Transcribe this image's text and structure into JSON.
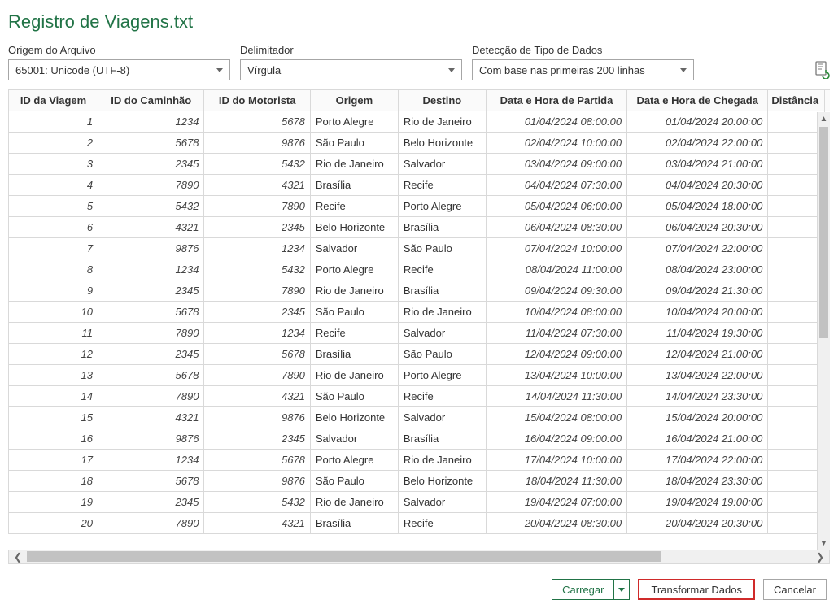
{
  "title": "Registro de Viagens.txt",
  "fields": {
    "origin_label": "Origem do Arquivo",
    "origin_value": "65001: Unicode (UTF-8)",
    "delimiter_label": "Delimitador",
    "delimiter_value": "Vírgula",
    "detect_label": "Detecção de Tipo de Dados",
    "detect_value": "Com base nas primeiras 200 linhas"
  },
  "columns": [
    "ID da Viagem",
    "ID do Caminhão",
    "ID do Motorista",
    "Origem",
    "Destino",
    "Data e Hora de Partida",
    "Data e Hora de Chegada",
    "Distância"
  ],
  "rows": [
    {
      "id": 1,
      "truck": 1234,
      "driver": 5678,
      "orig": "Porto Alegre",
      "dest": "Rio de Janeiro",
      "dep": "01/04/2024 08:00:00",
      "arr": "01/04/2024 20:00:00"
    },
    {
      "id": 2,
      "truck": 5678,
      "driver": 9876,
      "orig": "São Paulo",
      "dest": "Belo Horizonte",
      "dep": "02/04/2024 10:00:00",
      "arr": "02/04/2024 22:00:00"
    },
    {
      "id": 3,
      "truck": 2345,
      "driver": 5432,
      "orig": "Rio de Janeiro",
      "dest": "Salvador",
      "dep": "03/04/2024 09:00:00",
      "arr": "03/04/2024 21:00:00"
    },
    {
      "id": 4,
      "truck": 7890,
      "driver": 4321,
      "orig": "Brasília",
      "dest": "Recife",
      "dep": "04/04/2024 07:30:00",
      "arr": "04/04/2024 20:30:00"
    },
    {
      "id": 5,
      "truck": 5432,
      "driver": 7890,
      "orig": "Recife",
      "dest": "Porto Alegre",
      "dep": "05/04/2024 06:00:00",
      "arr": "05/04/2024 18:00:00"
    },
    {
      "id": 6,
      "truck": 4321,
      "driver": 2345,
      "orig": "Belo Horizonte",
      "dest": "Brasília",
      "dep": "06/04/2024 08:30:00",
      "arr": "06/04/2024 20:30:00"
    },
    {
      "id": 7,
      "truck": 9876,
      "driver": 1234,
      "orig": "Salvador",
      "dest": "São Paulo",
      "dep": "07/04/2024 10:00:00",
      "arr": "07/04/2024 22:00:00"
    },
    {
      "id": 8,
      "truck": 1234,
      "driver": 5432,
      "orig": "Porto Alegre",
      "dest": "Recife",
      "dep": "08/04/2024 11:00:00",
      "arr": "08/04/2024 23:00:00"
    },
    {
      "id": 9,
      "truck": 2345,
      "driver": 7890,
      "orig": "Rio de Janeiro",
      "dest": "Brasília",
      "dep": "09/04/2024 09:30:00",
      "arr": "09/04/2024 21:30:00"
    },
    {
      "id": 10,
      "truck": 5678,
      "driver": 2345,
      "orig": "São Paulo",
      "dest": "Rio de Janeiro",
      "dep": "10/04/2024 08:00:00",
      "arr": "10/04/2024 20:00:00"
    },
    {
      "id": 11,
      "truck": 7890,
      "driver": 1234,
      "orig": "Recife",
      "dest": "Salvador",
      "dep": "11/04/2024 07:30:00",
      "arr": "11/04/2024 19:30:00"
    },
    {
      "id": 12,
      "truck": 2345,
      "driver": 5678,
      "orig": "Brasília",
      "dest": "São Paulo",
      "dep": "12/04/2024 09:00:00",
      "arr": "12/04/2024 21:00:00"
    },
    {
      "id": 13,
      "truck": 5678,
      "driver": 7890,
      "orig": "Rio de Janeiro",
      "dest": "Porto Alegre",
      "dep": "13/04/2024 10:00:00",
      "arr": "13/04/2024 22:00:00"
    },
    {
      "id": 14,
      "truck": 7890,
      "driver": 4321,
      "orig": "São Paulo",
      "dest": "Recife",
      "dep": "14/04/2024 11:30:00",
      "arr": "14/04/2024 23:30:00"
    },
    {
      "id": 15,
      "truck": 4321,
      "driver": 9876,
      "orig": "Belo Horizonte",
      "dest": "Salvador",
      "dep": "15/04/2024 08:00:00",
      "arr": "15/04/2024 20:00:00"
    },
    {
      "id": 16,
      "truck": 9876,
      "driver": 2345,
      "orig": "Salvador",
      "dest": "Brasília",
      "dep": "16/04/2024 09:00:00",
      "arr": "16/04/2024 21:00:00"
    },
    {
      "id": 17,
      "truck": 1234,
      "driver": 5678,
      "orig": "Porto Alegre",
      "dest": "Rio de Janeiro",
      "dep": "17/04/2024 10:00:00",
      "arr": "17/04/2024 22:00:00"
    },
    {
      "id": 18,
      "truck": 5678,
      "driver": 9876,
      "orig": "São Paulo",
      "dest": "Belo Horizonte",
      "dep": "18/04/2024 11:30:00",
      "arr": "18/04/2024 23:30:00"
    },
    {
      "id": 19,
      "truck": 2345,
      "driver": 5432,
      "orig": "Rio de Janeiro",
      "dest": "Salvador",
      "dep": "19/04/2024 07:00:00",
      "arr": "19/04/2024 19:00:00"
    },
    {
      "id": 20,
      "truck": 7890,
      "driver": 4321,
      "orig": "Brasília",
      "dest": "Recife",
      "dep": "20/04/2024 08:30:00",
      "arr": "20/04/2024 20:30:00"
    }
  ],
  "buttons": {
    "load": "Carregar",
    "transform": "Transformar Dados",
    "cancel": "Cancelar"
  }
}
